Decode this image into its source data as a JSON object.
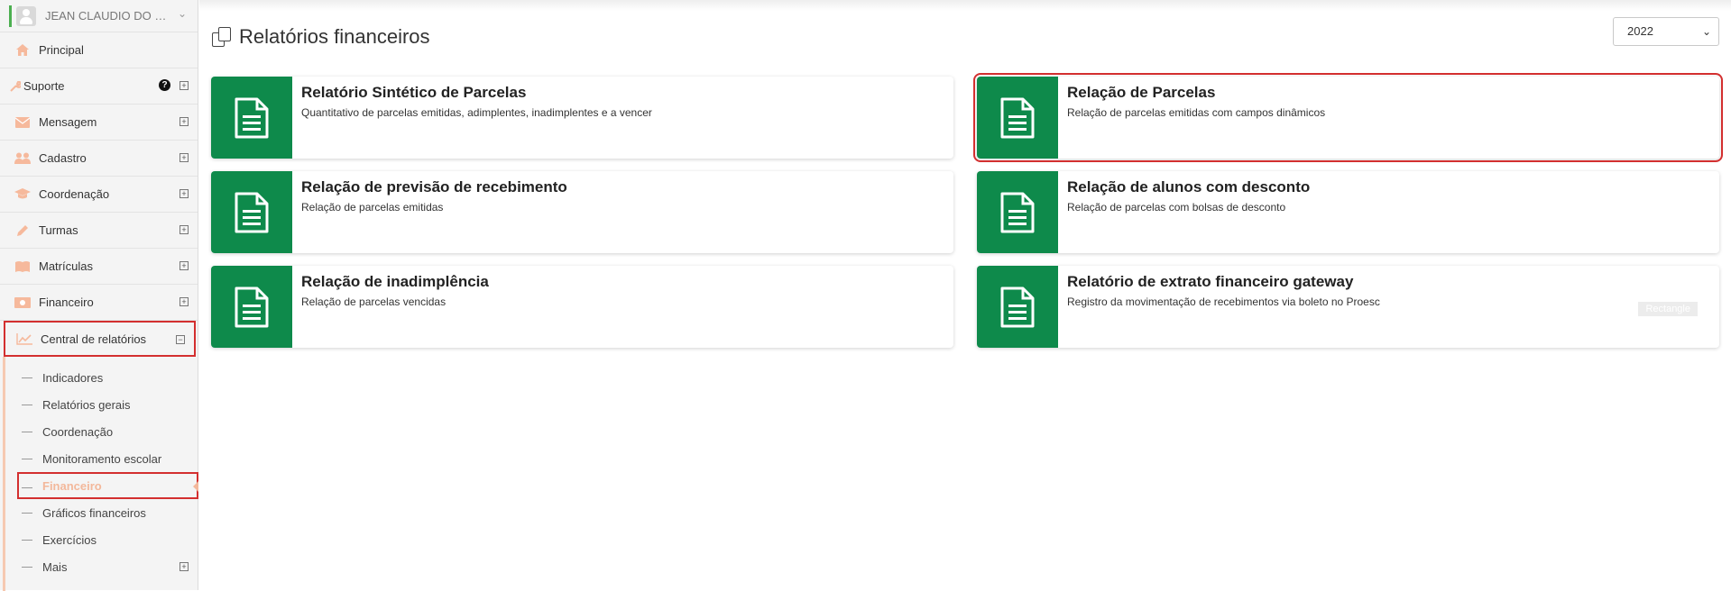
{
  "user": {
    "name": "JEAN CLAUDIO DO S..."
  },
  "sidebar": {
    "items": [
      {
        "label": "Principal"
      },
      {
        "label": "Suporte"
      },
      {
        "label": "Mensagem"
      },
      {
        "label": "Cadastro"
      },
      {
        "label": "Coordenação"
      },
      {
        "label": "Turmas"
      },
      {
        "label": "Matrículas"
      },
      {
        "label": "Financeiro"
      },
      {
        "label": "Central de relatórios"
      }
    ],
    "submenu": [
      {
        "label": "Indicadores"
      },
      {
        "label": "Relatórios gerais"
      },
      {
        "label": "Coordenação"
      },
      {
        "label": "Monitoramento escolar"
      },
      {
        "label": "Financeiro"
      },
      {
        "label": "Gráficos financeiros"
      },
      {
        "label": "Exercícios"
      },
      {
        "label": "Mais"
      }
    ]
  },
  "main": {
    "title": "Relatórios financeiros",
    "year_selected": "2022",
    "cards": [
      {
        "title": "Relatório Sintético de Parcelas",
        "desc": "Quantitativo de parcelas emitidas, adimplentes, inadimplentes e a vencer"
      },
      {
        "title": "Relação de Parcelas",
        "desc": "Relação de parcelas emitidas com campos dinâmicos"
      },
      {
        "title": "Relação de previsão de recebimento",
        "desc": "Relação de parcelas emitidas"
      },
      {
        "title": "Relação de alunos com desconto",
        "desc": "Relação de parcelas com bolsas de desconto"
      },
      {
        "title": "Relação de inadimplência",
        "desc": "Relação de parcelas vencidas"
      },
      {
        "title": "Relatório de extrato financeiro gateway",
        "desc": "Registro da movimentação de recebimentos via boleto no Proesc",
        "badge": "Rectangle"
      }
    ]
  },
  "colors": {
    "accent": "#0e8a4b",
    "highlight": "#d32f2f",
    "icon": "#f6b99c"
  }
}
